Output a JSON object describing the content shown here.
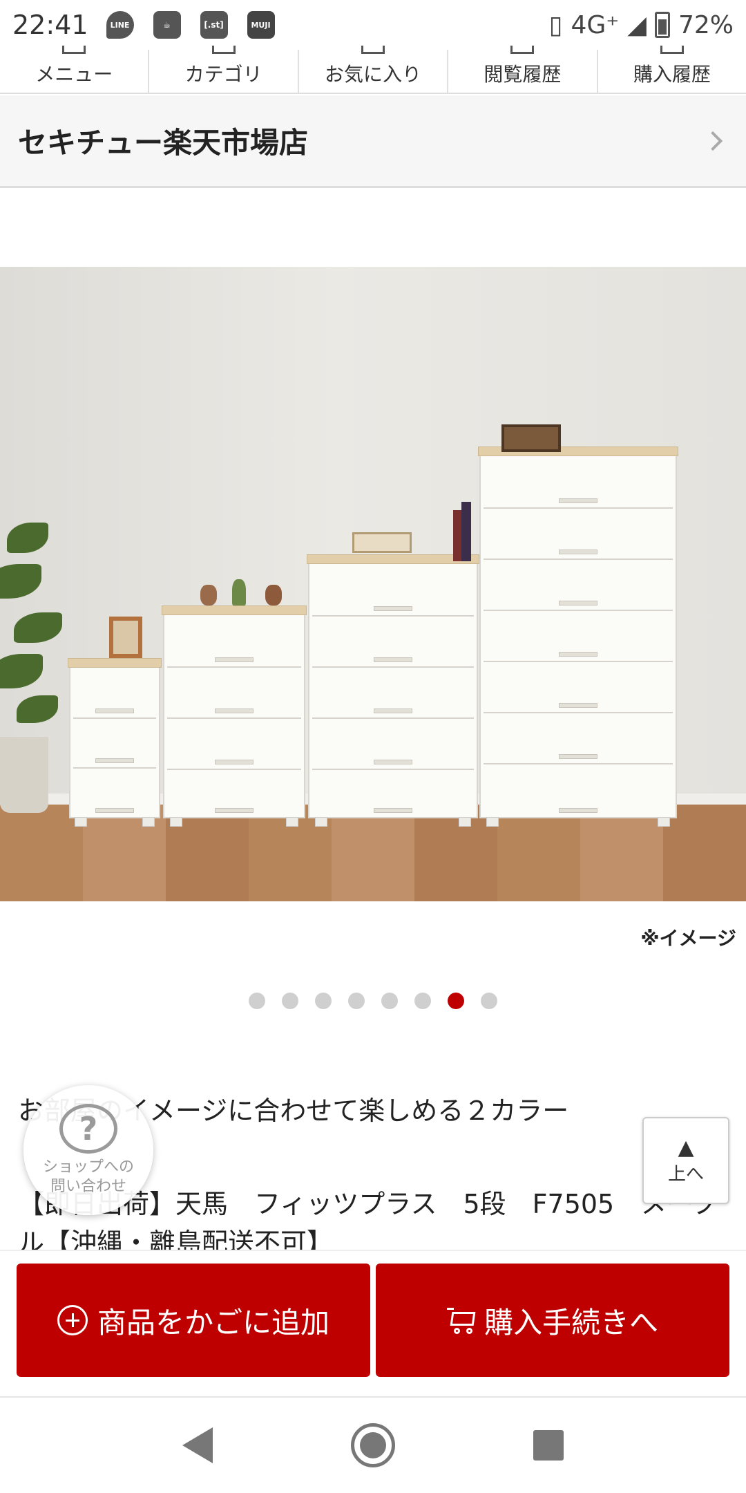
{
  "status_bar": {
    "time": "22:41",
    "app_icons": [
      {
        "name": "line-icon",
        "text": "LINE"
      },
      {
        "name": "teacup-icon",
        "text": ""
      },
      {
        "name": "dotst-icon",
        "text": "[.st]"
      },
      {
        "name": "muji-icon",
        "text": "MUJI"
      }
    ],
    "network": "4G⁺",
    "battery": "72%"
  },
  "top_nav": {
    "items": [
      {
        "label": "メニュー"
      },
      {
        "label": "カテゴリ"
      },
      {
        "label": "お気に入り"
      },
      {
        "label": "閲覧履歴"
      },
      {
        "label": "購入履歴"
      }
    ]
  },
  "shop": {
    "name": "セキチュー楽天市場店"
  },
  "gallery": {
    "caption": "※イメージ",
    "total": 8,
    "active_index": 6
  },
  "product": {
    "catch_copy": "お部屋のイメージに合わせて楽しめる２カラー",
    "title": "【即日出荷】天馬　フィッツプラス　5段　F7505　メープル【沖縄・離島配送不可】"
  },
  "inquiry": {
    "symbol": "?",
    "label_line1": "ショップへの",
    "label_line2": "問い合わせ"
  },
  "scroll_top": {
    "arrow": "▲",
    "label": "上へ"
  },
  "actions": {
    "add_to_cart": "商品をかごに追加",
    "checkout": "購入手続きへ"
  },
  "colors": {
    "accent": "#bf0000",
    "dot_inactive": "#cfcfcf"
  }
}
